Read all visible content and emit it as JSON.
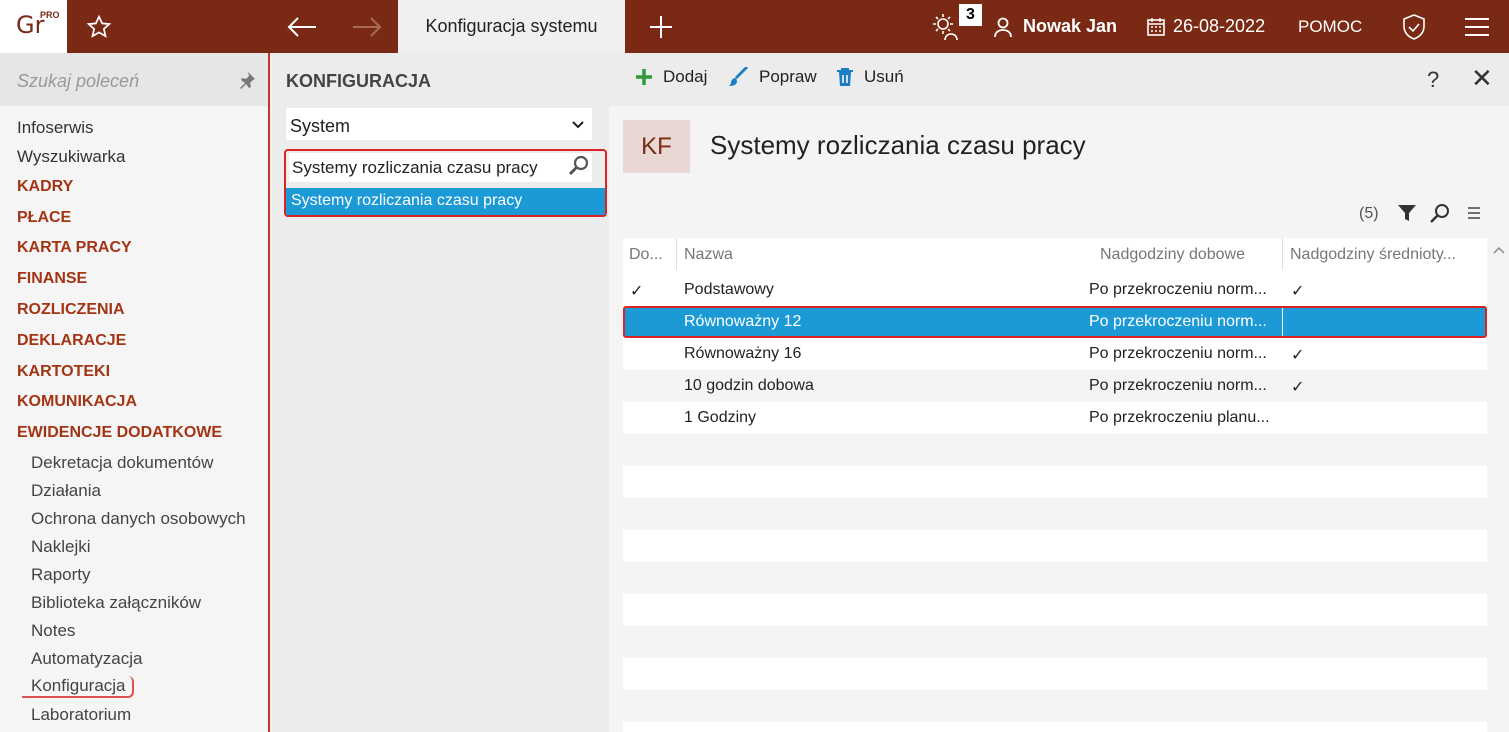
{
  "topbar": {
    "logo_text": "Gr",
    "logo_super": "PRO",
    "active_tab": "Konfiguracja systemu",
    "notifications_count": "3",
    "user_name": "Nowak Jan",
    "date": "26-08-2022",
    "help_label": "POMOC"
  },
  "leftnav": {
    "search_placeholder": "Szukaj poleceń",
    "top_items": [
      "Infoserwis",
      "Wyszukiwarka"
    ],
    "categories": [
      "KADRY",
      "PŁACE",
      "KARTA PRACY",
      "FINANSE",
      "ROZLICZENIA",
      "DEKLARACJE",
      "KARTOTEKI",
      "KOMUNIKACJA",
      "EWIDENCJE DODATKOWE"
    ],
    "sub_items": [
      "Dekretacja dokumentów",
      "Działania",
      "Ochrona danych osobowych",
      "Naklejki",
      "Raporty",
      "Biblioteka załączników",
      "Notes",
      "Automatyzacja",
      "Konfiguracja",
      "Laboratorium"
    ]
  },
  "midpanel": {
    "title": "KONFIGURACJA",
    "selected_group": "System",
    "search_value": "Systemy rozliczania czasu pracy",
    "search_result": "Systemy rozliczania czasu pracy"
  },
  "rightpanel": {
    "toolbar": {
      "add": "Dodaj",
      "edit": "Popraw",
      "delete": "Usuń",
      "help": "?",
      "close": "✕"
    },
    "badge": "KF",
    "title": "Systemy rozliczania czasu pracy",
    "count": "(5)",
    "columns": [
      "Do...",
      "Nazwa",
      "Nadgodziny dobowe",
      "Nadgodziny średnioty..."
    ],
    "rows": [
      {
        "default": "✓",
        "name": "Podstawowy",
        "daily": "Po przekroczeniu norm...",
        "avg": "✓"
      },
      {
        "default": "",
        "name": "Równoważny 12",
        "daily": "Po przekroczeniu norm...",
        "avg": ""
      },
      {
        "default": "",
        "name": "Równoważny 16",
        "daily": "Po przekroczeniu norm...",
        "avg": "✓"
      },
      {
        "default": "",
        "name": "10 godzin dobowa",
        "daily": "Po przekroczeniu norm...",
        "avg": "✓"
      },
      {
        "default": "",
        "name": "1 Godziny",
        "daily": "Po przekroczeniu planu...",
        "avg": ""
      }
    ]
  }
}
